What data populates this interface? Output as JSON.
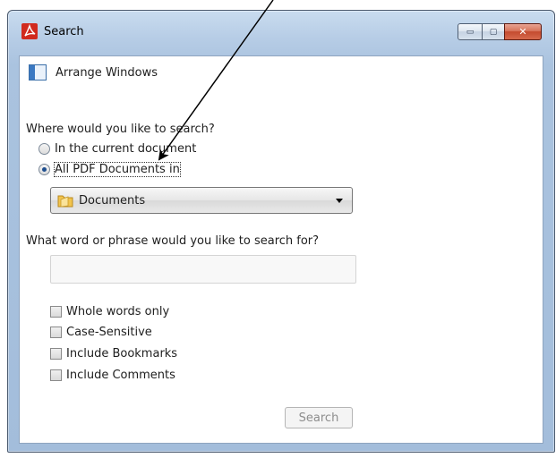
{
  "window": {
    "title": "Search",
    "controls": {
      "minimize": "▭",
      "maximize": "▢",
      "close": "✕"
    }
  },
  "arrange": {
    "label": "Arrange Windows"
  },
  "scope": {
    "question": "Where would you like to search?",
    "options": [
      {
        "label": "In the current document",
        "checked": false
      },
      {
        "label": "All PDF Documents in",
        "checked": true
      }
    ],
    "location": {
      "value": "Documents",
      "icon": "folder-icon"
    }
  },
  "query": {
    "question": "What word or phrase would you like to search for?",
    "value": "",
    "placeholder": ""
  },
  "options": {
    "whole_words": "Whole words only",
    "case_sensitive": "Case-Sensitive",
    "include_bookmarks": "Include Bookmarks",
    "include_comments": "Include Comments"
  },
  "actions": {
    "search_label": "Search"
  },
  "colors": {
    "title_gradient": "#b7cde6",
    "acrobat_red": "#d12a1e",
    "radio_selected": "#1f4f8f"
  }
}
